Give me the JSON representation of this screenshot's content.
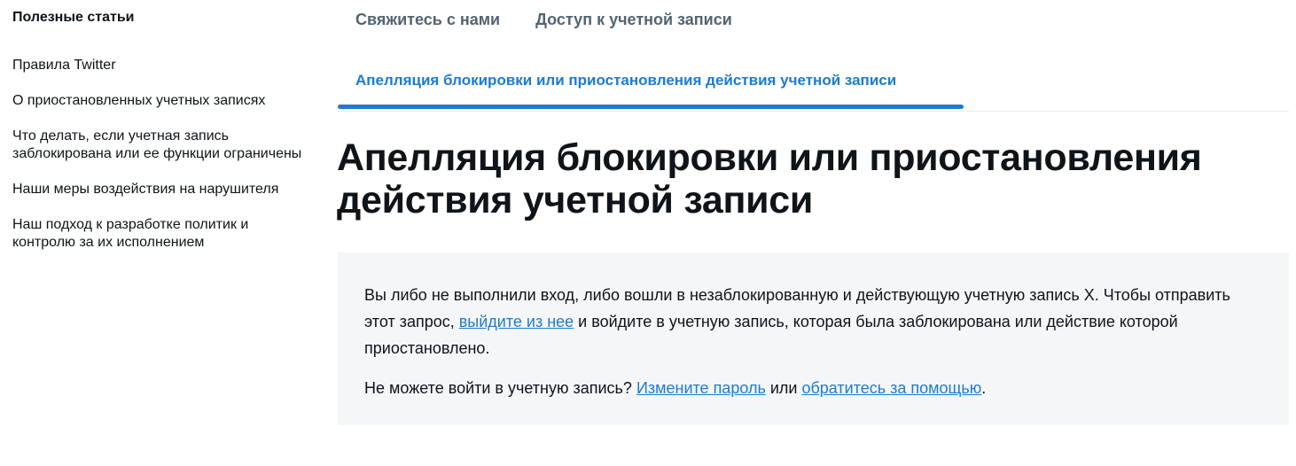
{
  "sidebar": {
    "heading": "Полезные статьи",
    "items": [
      {
        "label": "Правила Twitter"
      },
      {
        "label": "О приостановленных учетных записях"
      },
      {
        "label": "Что делать, если учетная запись заблокирована или ее функции ограничены"
      },
      {
        "label": "Наши меры воздействия на нарушителя"
      },
      {
        "label": "Наш подход к разработке политик и контролю за их исполнением"
      }
    ]
  },
  "top_nav": {
    "items": [
      {
        "label": "Свяжитесь с нами"
      },
      {
        "label": "Доступ к учетной записи"
      }
    ]
  },
  "sub_tab": {
    "label": "Апелляция блокировки или приостановления действия учетной записи"
  },
  "main": {
    "title": "Апелляция блокировки или приостановления действия учетной записи",
    "notice": {
      "p1_before": "Вы либо не выполнили вход, либо вошли в незаблокированную и действующую учетную запись X. Чтобы отправить этот запрос, ",
      "p1_link": "выйдите из нее",
      "p1_after": " и войдите в учетную запись, которая была заблокирована или действие которой приостановлено.",
      "p2_before": "Не можете войти в учетную запись? ",
      "p2_link1": "Измените пароль",
      "p2_between": " или ",
      "p2_link2": "обратитесь за помощью",
      "p2_after": "."
    }
  },
  "colors": {
    "accent": "#1d7bd0",
    "nav_text": "#536471",
    "notice_bg": "#f4f6f8",
    "text": "#0f1419"
  }
}
